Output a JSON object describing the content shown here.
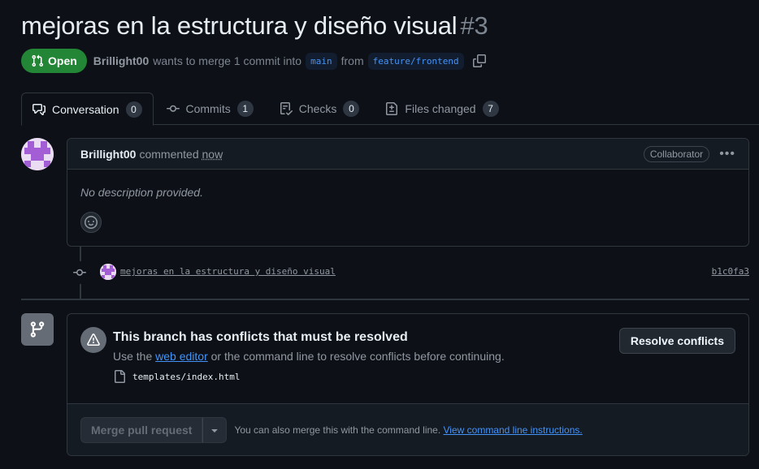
{
  "pr": {
    "title": "mejoras en la estructura y diseño visual",
    "number": "#3",
    "state": "Open",
    "author": "Brillight00",
    "action_text": "wants to merge 1 commit into",
    "base_branch": "main",
    "from_text": "from",
    "head_branch": "feature/frontend"
  },
  "tabs": [
    {
      "label": "Conversation",
      "count": "0",
      "icon": "comment-discussion-icon"
    },
    {
      "label": "Commits",
      "count": "1",
      "icon": "commit-icon"
    },
    {
      "label": "Checks",
      "count": "0",
      "icon": "checklist-icon"
    },
    {
      "label": "Files changed",
      "count": "7",
      "icon": "file-diff-icon"
    }
  ],
  "comment": {
    "author": "Brillight00",
    "action": "commented",
    "time": "now",
    "role": "Collaborator",
    "body": "No description provided."
  },
  "commit": {
    "message": "mejoras en la estructura y diseño visual",
    "sha": "b1c0fa3"
  },
  "merge": {
    "conflict_title": "This branch has conflicts that must be resolved",
    "conflict_desc_prefix": "Use the",
    "conflict_desc_link": "web editor",
    "conflict_desc_suffix": "or the command line to resolve conflicts before continuing.",
    "conflict_file": "templates/index.html",
    "resolve_label": "Resolve conflicts",
    "merge_label": "Merge pull request",
    "hint_text": "You can also merge this with the command line.",
    "hint_link": "View command line instructions."
  },
  "colors": {
    "open_badge": "#238636",
    "link": "#4493f8",
    "background": "#0d1117"
  }
}
